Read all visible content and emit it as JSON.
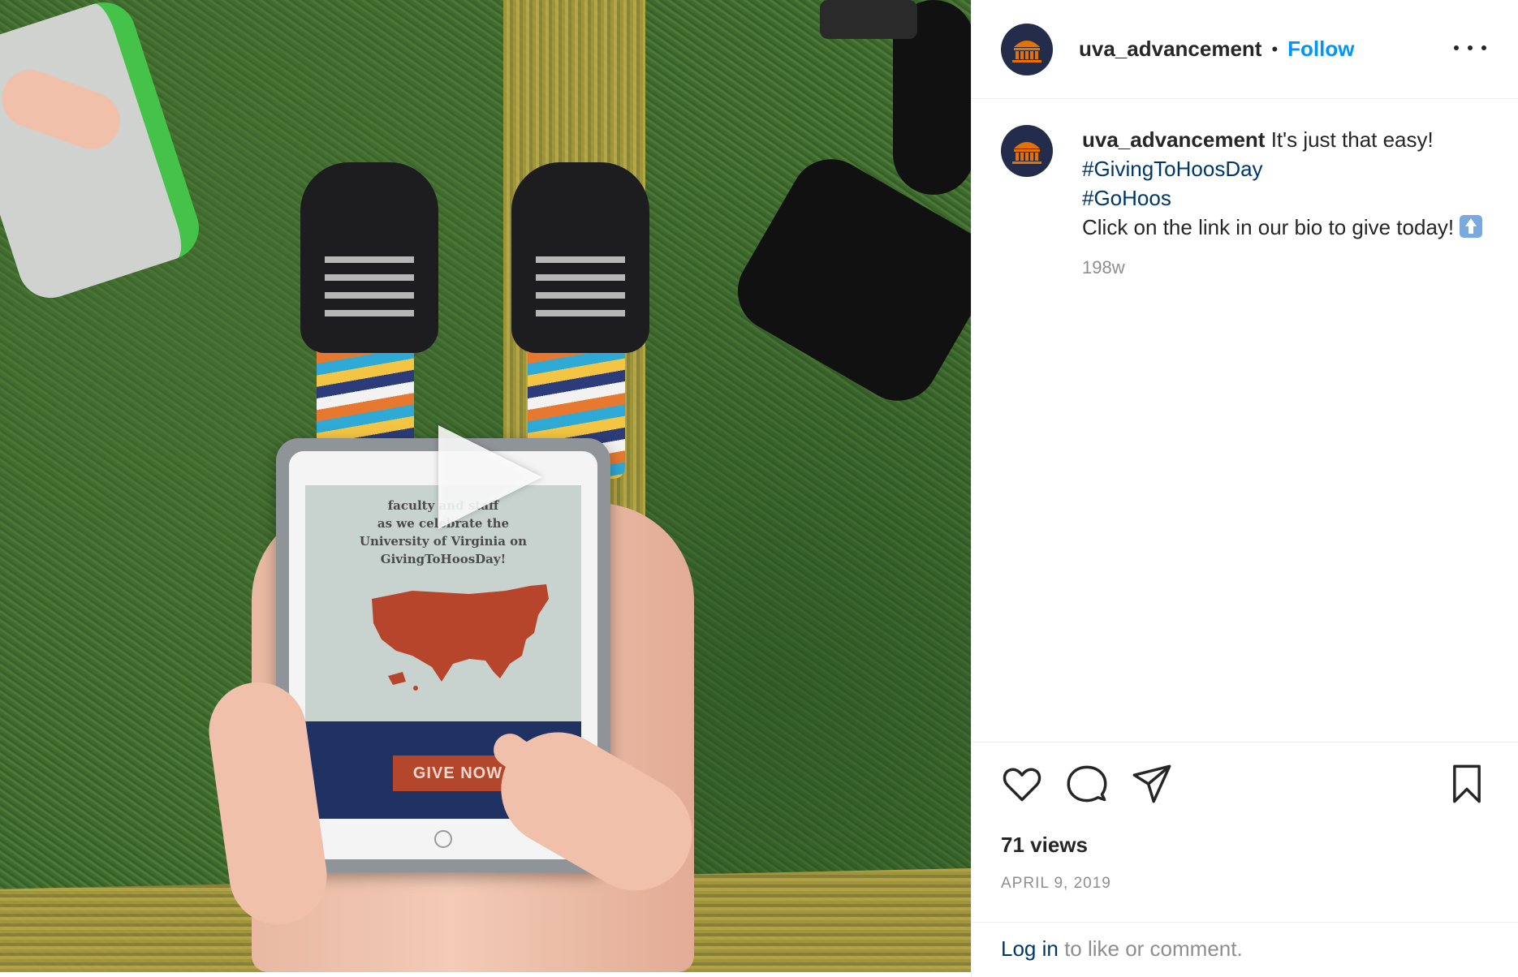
{
  "post": {
    "username": "uva_advancement",
    "follow_label": "Follow",
    "caption_text": "It's just that easy!",
    "hashtags": [
      "#GivingToHoosDay",
      "#GoHoos"
    ],
    "caption_cta": "Click on the link in our bio to give today!",
    "emoji": "up-arrow-emoji",
    "relative_time": "198w",
    "views": "71 views",
    "date": "APRIL 9, 2019"
  },
  "media": {
    "tablet_text": [
      "faculty and staff",
      "as we celebrate the",
      "University of Virginia on",
      "GivingToHoosDay!"
    ],
    "tablet_button": "GIVE NOW"
  },
  "footer": {
    "login_link": "Log in",
    "login_rest": " to like or comment."
  },
  "icons": {
    "avatar": "rotunda-logo-icon",
    "like": "heart-icon",
    "comment": "comment-bubble-icon",
    "share": "paper-plane-icon",
    "save": "bookmark-icon",
    "more": "more-options-icon",
    "play": "play-icon"
  },
  "colors": {
    "follow": "#0095f6",
    "hashtag": "#00376b",
    "avatar_bg": "#232d4b",
    "avatar_accent": "#e57200",
    "muted": "#8e8e8e"
  }
}
